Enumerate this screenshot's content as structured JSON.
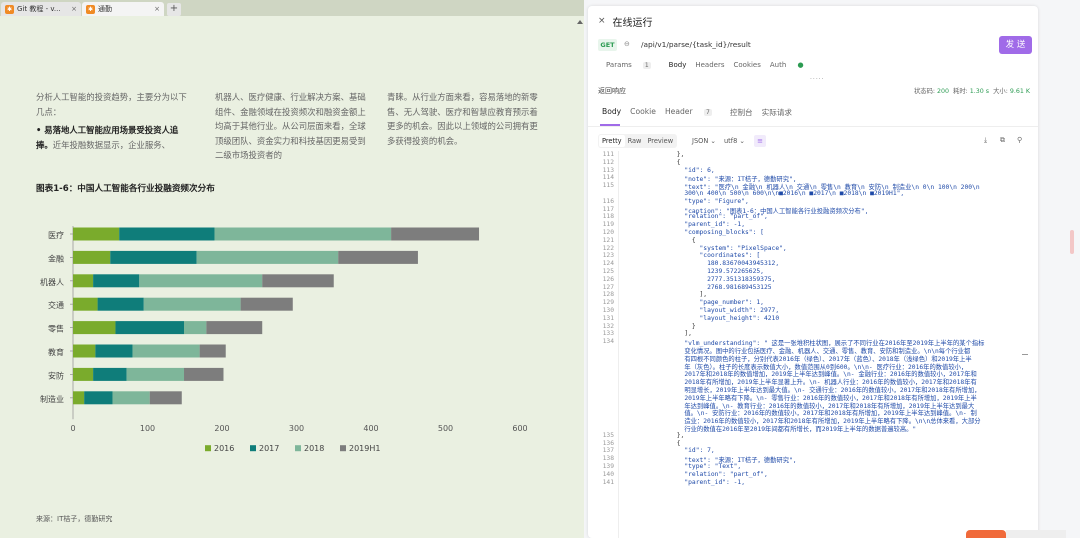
{
  "browser": {
    "tabs": [
      {
        "title": "Git 教程 - v...",
        "active": false
      },
      {
        "title": "通勤",
        "active": true
      }
    ],
    "new_tab": "+",
    "close": "×"
  },
  "document": {
    "col1_intro": "分析人工智能的投资趋势，主要分为以下几点：",
    "col1_bullet_bold": "易落地人工智能应用场景受投资人追捧。",
    "col1_bullet_text": "近年投融数据显示，企业服务、",
    "col2": "机器人、医疗健康、行业解决方案、基础组件、金融领域在投资频次和融资金额上均高于其他行业。从公司层面来看，全球顶级团队、资金实力和科技基因更易受到二级市场投资者的",
    "col3": "青睐。从行业方面来看，容易落地的新零售、无人驾驶、医疗和智慧应教育预示着更多的机会。因此以上领域的公司拥有更多获得投资的机会。",
    "source": "来源：IT桔子，德勤研究"
  },
  "chart_data": {
    "type": "bar",
    "orientation": "horizontal",
    "stacked": true,
    "title": "图表1-6：中国人工智能各行业投融资频次分布",
    "categories": [
      "医疗",
      "金融",
      "机器人",
      "交通",
      "零售",
      "教育",
      "安防",
      "制造业"
    ],
    "series": [
      {
        "name": "2016",
        "color": "#7aab2c",
        "values": [
          62,
          50,
          27,
          33,
          57,
          30,
          27,
          15
        ]
      },
      {
        "name": "2017",
        "color": "#0f7d7a",
        "values": [
          128,
          116,
          62,
          62,
          92,
          50,
          45,
          38
        ]
      },
      {
        "name": "2018",
        "color": "#7eb69a",
        "values": [
          237,
          190,
          165,
          130,
          30,
          90,
          77,
          50
        ]
      },
      {
        "name": "2019H1",
        "color": "#7d7d7d",
        "values": [
          118,
          107,
          96,
          70,
          75,
          35,
          53,
          43
        ]
      }
    ],
    "xlim": [
      0,
      600
    ],
    "xticks": [
      0,
      100,
      200,
      300,
      400,
      500,
      600
    ],
    "grid": false,
    "legend": "bottom"
  },
  "panel": {
    "title": "在线运行",
    "close": "×",
    "method": "GET",
    "link_icon": "⊖",
    "url": "/api/v1/parse/{task_id}/result",
    "send": "发 送",
    "req_tabs": {
      "params": "Params",
      "params_count": "1",
      "body": "Body",
      "headers": "Headers",
      "cookies": "Cookies",
      "auth": "Auth",
      "auth_dot": "●"
    },
    "drag": "·····",
    "response_title": "返回响应",
    "status_label": "状态码:",
    "status": "200",
    "time_label": "耗时:",
    "time": "1.30 s",
    "size_label": "大小:",
    "size": "9.61 K",
    "resp_tabs": {
      "body": "Body",
      "cookie": "Cookie",
      "header": "Header",
      "header_count": "7",
      "console": "控制台",
      "actual": "实际请求"
    },
    "format": {
      "pretty": "Pretty",
      "raw": "Raw",
      "preview": "Preview",
      "json": "JSON",
      "encoding": "utf8",
      "chevron": "⌄",
      "fmt_icon": "≡",
      "download": "⤓",
      "copy": "⧉",
      "search": "⚲"
    }
  },
  "code_lines": [
    {
      "n": "111",
      "t": "      },",
      "c": "#333"
    },
    {
      "n": "112",
      "t": "      {",
      "c": "#333"
    },
    {
      "n": "113",
      "t": "        \"id\": 6,",
      "c": "#1f4aa8"
    },
    {
      "n": "114",
      "t": "        \"note\": \"来源：IT桔子，德勤研究\",",
      "c": "#1f4aa8"
    },
    {
      "n": "115",
      "t": "        \"text\": \"医疗\\n 金融\\n 机器人\\n 交通\\n 零售\\n 教育\\n 安防\\n 制造业\\n 0\\n 100\\n 200\\n",
      "c": "#1f4aa8"
    },
    {
      "n": "",
      "t": "        300\\n 400\\n 500\\n 600\\n\\n■2016\\n ■2017\\n ■2018\\n ■2019H1\",",
      "c": "#1f4aa8"
    },
    {
      "n": "116",
      "t": "        \"type\": \"Figure\",",
      "c": "#1f4aa8"
    },
    {
      "n": "117",
      "t": "        \"caption\": \"图表1-6：中国人工智能各行业投融资频次分布\",",
      "c": "#1f4aa8"
    },
    {
      "n": "118",
      "t": "        \"relation\": \"part_of\",",
      "c": "#1f4aa8"
    },
    {
      "n": "119",
      "t": "        \"parent_id\": -1,",
      "c": "#1f4aa8"
    },
    {
      "n": "120",
      "t": "        \"composing_blocks\": [",
      "c": "#1f4aa8"
    },
    {
      "n": "121",
      "t": "          {",
      "c": "#333"
    },
    {
      "n": "122",
      "t": "            \"system\": \"PixelSpace\",",
      "c": "#1f4aa8"
    },
    {
      "n": "123",
      "t": "            \"coordinates\": [",
      "c": "#1f4aa8"
    },
    {
      "n": "124",
      "t": "              180.83670043945312,",
      "c": "#1f4aa8"
    },
    {
      "n": "125",
      "t": "              1239.572265625,",
      "c": "#1f4aa8"
    },
    {
      "n": "126",
      "t": "              2777.351318359375,",
      "c": "#1f4aa8"
    },
    {
      "n": "127",
      "t": "              2768.981689453125",
      "c": "#1f4aa8"
    },
    {
      "n": "128",
      "t": "            ],",
      "c": "#333"
    },
    {
      "n": "129",
      "t": "            \"page_number\": 1,",
      "c": "#1f4aa8"
    },
    {
      "n": "130",
      "t": "            \"layout_width\": 2977,",
      "c": "#1f4aa8"
    },
    {
      "n": "131",
      "t": "            \"layout_height\": 4210",
      "c": "#1f4aa8"
    },
    {
      "n": "132",
      "t": "          }",
      "c": "#333"
    },
    {
      "n": "133",
      "t": "        ],",
      "c": "#333"
    },
    {
      "n": "134",
      "t": "        \"vlm_understanding\": \" 这是一张堆积柱状图，展示了不同行业在2016年至2019年上半年的某个指标",
      "c": "#1f4aa8"
    },
    {
      "n": "",
      "t": "        变化情况。图中的行业包括医疗、金融、机器人、交通、零售、教育、安防和制造业。\\n\\n每个行业都",
      "c": "#1f4aa8"
    },
    {
      "n": "",
      "t": "        有四根不同颜色的柱子，分别代表2016年（绿色）、2017年（蓝色）、2018年（浅绿色）和2019年上半",
      "c": "#1f4aa8"
    },
    {
      "n": "",
      "t": "        年（灰色）。柱子的长度表示数值大小，数值范围从0到600。\\n\\n- 医疗行业：2016年的数值较小，",
      "c": "#1f4aa8"
    },
    {
      "n": "",
      "t": "        2017年和2018年的数值增加，2019年上半年达到峰值。\\n- 金融行业：2016年的数值较小，2017年和",
      "c": "#1f4aa8"
    },
    {
      "n": "",
      "t": "        2018年有所增加，2019年上半年显著上升。\\n- 机器人行业：2016年的数值较小，2017年和2018年有",
      "c": "#1f4aa8"
    },
    {
      "n": "",
      "t": "        明显增长，2019年上半年达到最大值。\\n- 交通行业：2016年的数值较小，2017年和2018年有所增加，",
      "c": "#1f4aa8"
    },
    {
      "n": "",
      "t": "        2019年上半年略有下降。\\n- 零售行业：2016年的数值较小，2017年和2018年有所增加，2019年上半",
      "c": "#1f4aa8"
    },
    {
      "n": "",
      "t": "        年达到峰值。\\n- 教育行业：2016年的数值较小，2017年和2018年有所增加，2019年上半年达到最大",
      "c": "#1f4aa8"
    },
    {
      "n": "",
      "t": "        值。\\n- 安防行业：2016年的数值较小，2017年和2018年有所增加，2019年上半年达到峰值。\\n- 制",
      "c": "#1f4aa8"
    },
    {
      "n": "",
      "t": "        造业：2016年的数值较小，2017年和2018年有所增加，2019年上半年略有下降。\\n\\n总体来看，大部分",
      "c": "#1f4aa8"
    },
    {
      "n": "",
      "t": "        行业的数值在2016年至2019年间都有所增长，而2019年上半年的数据普遍较高。\"",
      "c": "#1f4aa8"
    },
    {
      "n": "135",
      "t": "      },",
      "c": "#333"
    },
    {
      "n": "136",
      "t": "      {",
      "c": "#333"
    },
    {
      "n": "137",
      "t": "        \"id\": 7,",
      "c": "#1f4aa8"
    },
    {
      "n": "138",
      "t": "        \"text\": \"来源：IT桔子，德勤研究\",",
      "c": "#1f4aa8"
    },
    {
      "n": "139",
      "t": "        \"type\": \"Text\",",
      "c": "#1f4aa8"
    },
    {
      "n": "140",
      "t": "        \"relation\": \"part_of\",",
      "c": "#1f4aa8"
    },
    {
      "n": "141",
      "t": "        \"parent_id\": -1,",
      "c": "#1f4aa8"
    }
  ]
}
